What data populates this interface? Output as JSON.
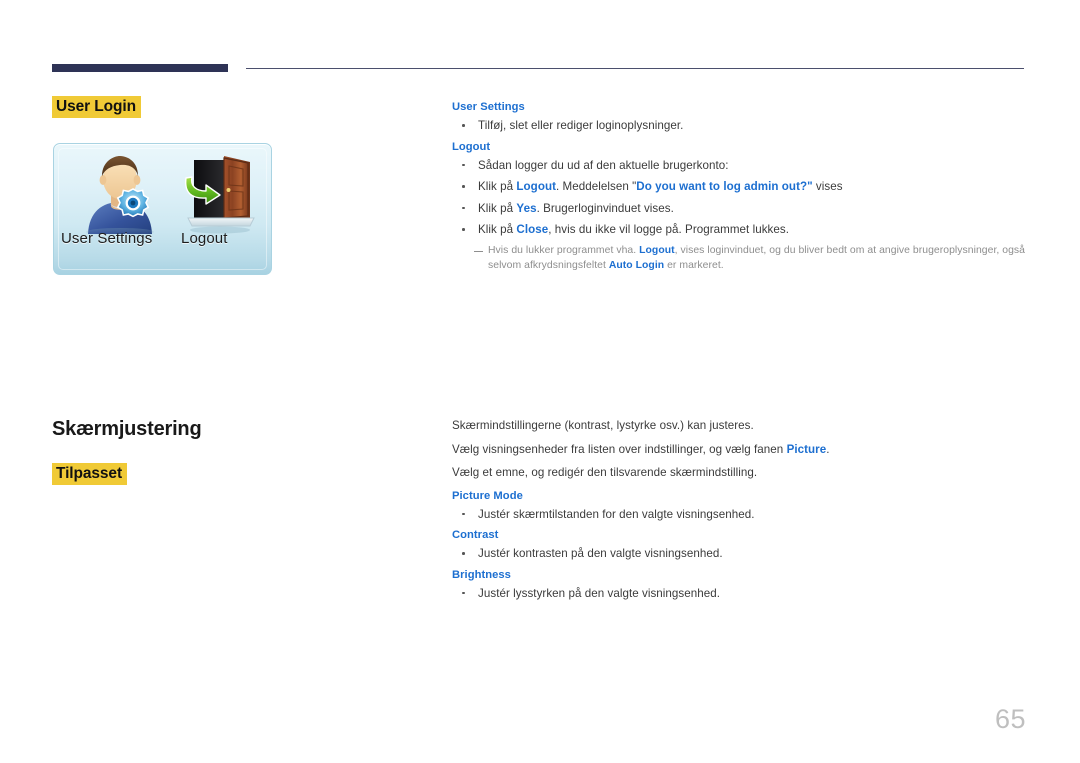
{
  "page": {
    "number": "65",
    "accent_navy": "#2e3356",
    "highlight_yellow": "#f0ca36",
    "link_blue": "#1d6fd0",
    "note_grey": "#8e8e8e"
  },
  "section1": {
    "title": "User Login",
    "illustration": {
      "label_user_settings": "User Settings",
      "label_logout": "Logout",
      "icon_user": "user-settings-icon",
      "icon_door": "logout-door-icon"
    },
    "right": {
      "head_user_settings": "User Settings",
      "bullet_user_settings": "Tilføj, slet eller rediger loginoplysninger.",
      "head_logout": "Logout",
      "bullet_logout_1": "Sådan logger du ud af den aktuelle brugerkonto:",
      "bullet_logout_2_pre": "Klik på ",
      "bullet_logout_2_b1": "Logout",
      "bullet_logout_2_mid": ". Meddelelsen \"",
      "bullet_logout_2_b2": "Do you want to log admin out?\"",
      "bullet_logout_2_post": " vises",
      "bullet_logout_3_pre": "Klik på ",
      "bullet_logout_3_b1": "Yes",
      "bullet_logout_3_post": ". Brugerloginvinduet vises.",
      "bullet_logout_4_pre": "Klik på ",
      "bullet_logout_4_b1": "Close",
      "bullet_logout_4_post": ", hvis du ikke vil logge på. Programmet lukkes.",
      "note_pre": "Hvis du lukker programmet vha. ",
      "note_b1": "Logout",
      "note_mid": ", vises loginvinduet, og du bliver bedt om at angive brugeroplysninger, også selvom afkrydsningsfeltet ",
      "note_b2": "Auto Login",
      "note_post": " er markeret."
    }
  },
  "section2": {
    "heading": "Skærmjustering",
    "subtitle": "Tilpasset",
    "right": {
      "para_1": "Skærmindstillingerne (kontrast, lystyrke osv.) kan justeres.",
      "para_2_pre": "Vælg visningsenheder fra listen over indstillinger, og vælg fanen ",
      "para_2_b1": "Picture",
      "para_2_post": ".",
      "para_3": "Vælg et emne, og redigér den tilsvarende skærmindstilling.",
      "head_picture_mode": "Picture Mode",
      "bullet_picture_mode": "Justér skærmtilstanden for den valgte visningsenhed.",
      "head_contrast": "Contrast",
      "bullet_contrast": "Justér kontrasten på den valgte visningsenhed.",
      "head_brightness": "Brightness",
      "bullet_brightness": "Justér lysstyrken på den valgte visningsenhed."
    }
  }
}
